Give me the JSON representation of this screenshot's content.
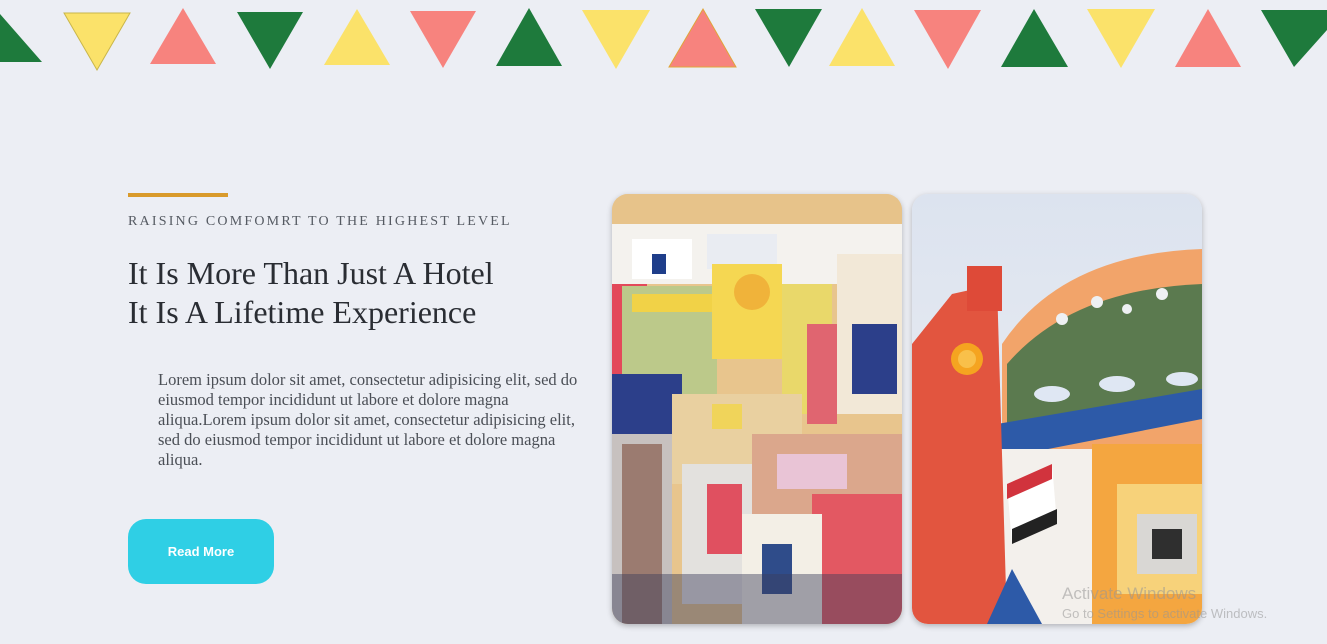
{
  "hero": {
    "eyebrow": "RAISING COMFOMRT TO THE HIGHEST LEVEL",
    "headline_line1": "It Is More Than Just A Hotel",
    "headline_line2": "It Is A Lifetime Experience",
    "body": "Lorem ipsum dolor sit amet, consectetur adipisicing elit, sed do eiusmod tempor incididunt ut labore et dolore magna aliqua.Lorem ipsum dolor sit amet, consectetur adipisicing elit, sed do eiusmod tempor incididunt ut labore et dolore magna aliqua.",
    "button_label": "Read More"
  },
  "watermark": {
    "line1": "Activate Windows",
    "line2": "Go to Settings to activate Windows."
  },
  "colors": {
    "accent": "#d99a2b",
    "button": "#2fcfe5",
    "background": "#eceef4",
    "bunting_green": "#1e7a3c",
    "bunting_yellow": "#fbe26a",
    "bunting_pink": "#f7837e"
  }
}
